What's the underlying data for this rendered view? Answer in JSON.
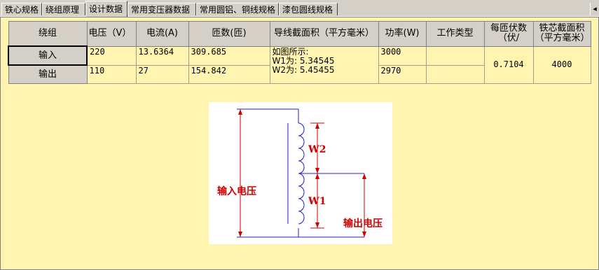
{
  "tabs": [
    "铁心规格",
    "绕组原理",
    "设计数据",
    "常用变压器数据",
    "常用圆铝、铜线规格",
    "漆包圆线规格"
  ],
  "tab_scroll": "ü",
  "table": {
    "headers": [
      "绕组",
      "电压（V）",
      "电流(A)",
      "匝数(匝)",
      "导线截面积（平方毫米）",
      "功率(W)",
      "工作类型",
      "每匝伏数（伏/",
      "铁芯截面积（平方毫米）"
    ],
    "rows": [
      {
        "name": "输入",
        "voltage": "220",
        "current": "13.6364",
        "turns": "309.685",
        "power": "3000",
        "work_type": ""
      },
      {
        "name": "输出",
        "voltage": "110",
        "current": "27",
        "turns": "154.842",
        "power": "2970",
        "work_type": ""
      }
    ],
    "wire_area": {
      "line1": "如图所示:",
      "line2": "W1为: 5.34545",
      "line3": "W2为: 5.45455"
    },
    "volts_per_turn": "0.7104",
    "core_area": "4000"
  },
  "diagram": {
    "input_label": "输入电压",
    "output_label": "输出电压",
    "w1_label": "W1",
    "w2_label": "W2",
    "line_color": "#2020c0",
    "dim_color": "#d00000"
  }
}
